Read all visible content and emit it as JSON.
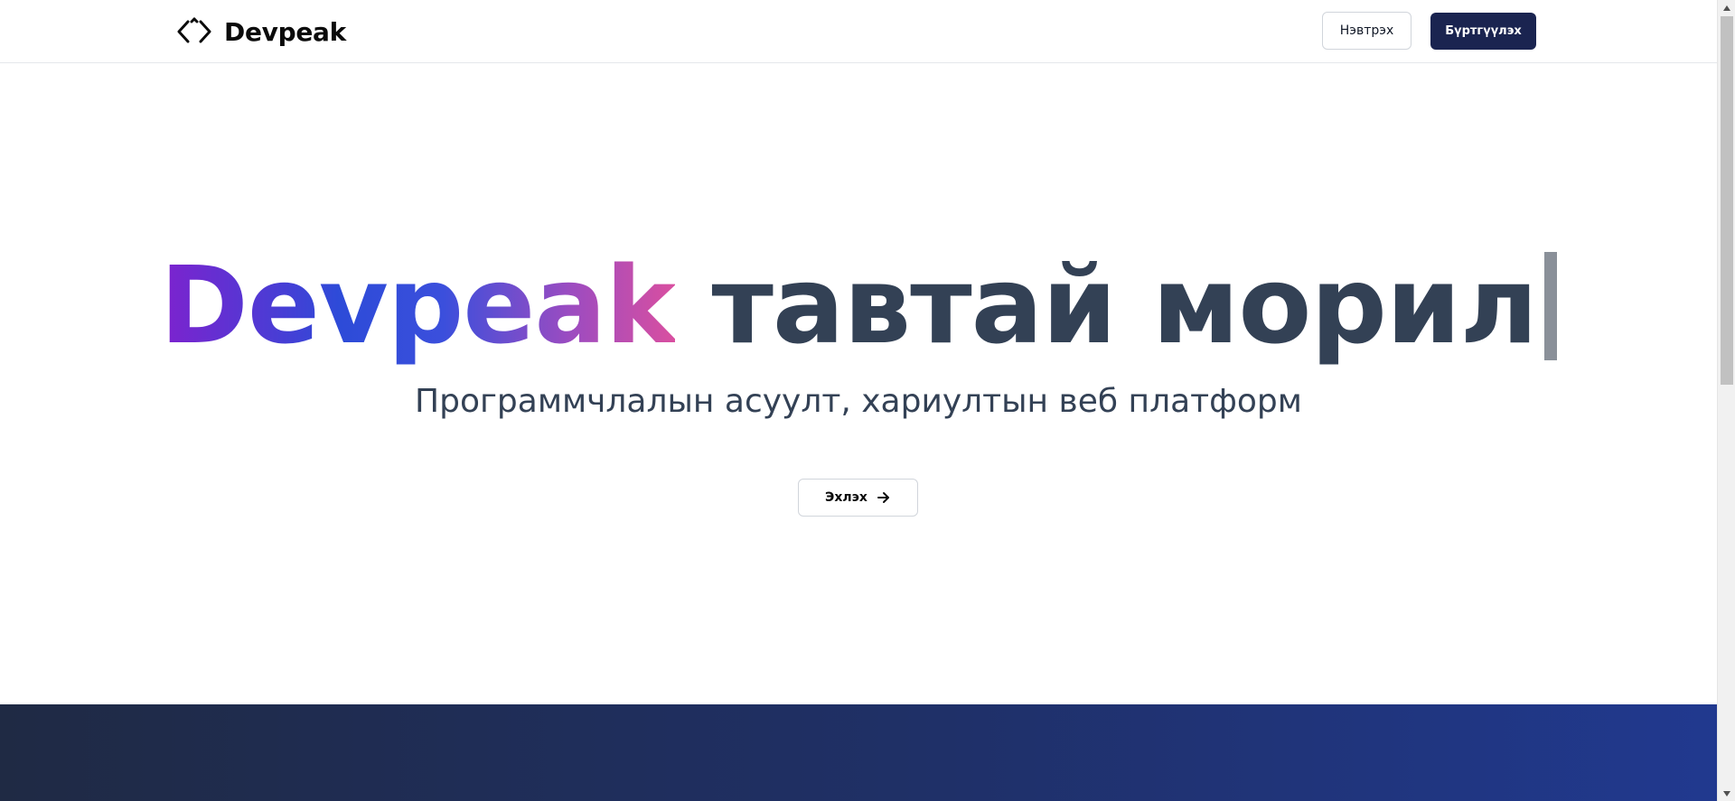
{
  "header": {
    "brand_name": "Devpeak",
    "login_label": "Нэвтрэх",
    "register_label": "Бүртгүүлэх"
  },
  "hero": {
    "title_brand": "Devpeak",
    "title_rest": " тавтай морил",
    "subtitle": "Программчлалын асуулт, хариултын веб платформ",
    "start_label": "Эхлэх"
  },
  "icons": {
    "brand": "code-brackets-icon",
    "start": "arrow-right-icon"
  },
  "colors": {
    "register_bg": "#1a2450",
    "title_text": "#334155",
    "gradient_start": "#7e22ce",
    "gradient_mid": "#2d4bd8",
    "gradient_end": "#d94fa0",
    "band_start": "#1f2a44",
    "band_end": "#21398f"
  }
}
